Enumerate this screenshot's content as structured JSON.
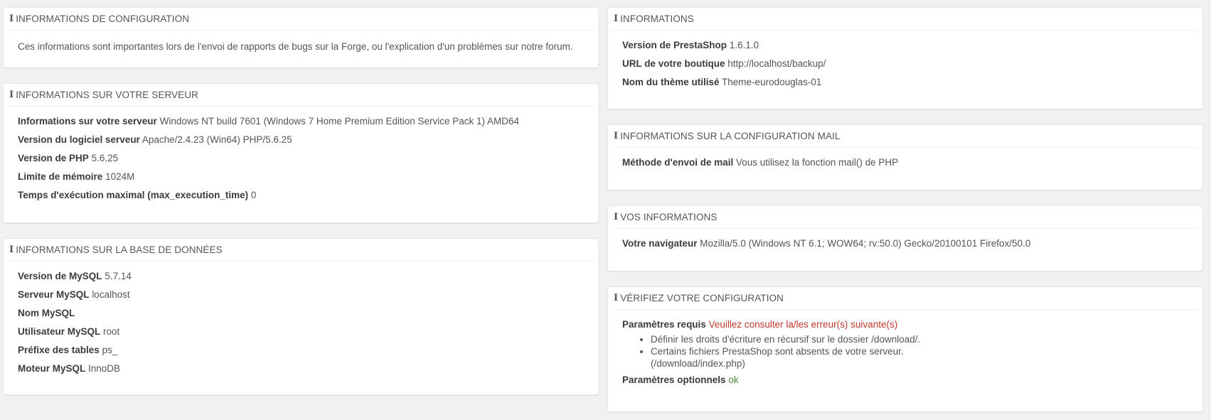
{
  "config_info": {
    "title": "INFORMATIONS DE CONFIGURATION",
    "text": "Ces informations sont importantes lors de l'envoi de rapports de bugs sur la Forge, ou l'explication d'un problèmes sur notre forum."
  },
  "server_info": {
    "title": "INFORMATIONS SUR VOTRE SERVEUR",
    "rows": [
      {
        "label": "Informations sur votre serveur",
        "value": "Windows NT build 7601 (Windows 7 Home Premium Edition Service Pack 1) AMD64"
      },
      {
        "label": "Version du logiciel serveur",
        "value": "Apache/2.4.23 (Win64) PHP/5.6.25"
      },
      {
        "label": "Version de PHP",
        "value": "5.6.25"
      },
      {
        "label": "Limite de mémoire",
        "value": "1024M"
      },
      {
        "label": "Temps d'exécution maximal (max_execution_time)",
        "value": "0"
      }
    ]
  },
  "db_info": {
    "title": "INFORMATIONS SUR LA BASE DE DONNÉES",
    "rows": [
      {
        "label": "Version de MySQL",
        "value": "5.7.14"
      },
      {
        "label": "Serveur MySQL",
        "value": "localhost"
      },
      {
        "label": "Nom MySQL",
        "value": ""
      },
      {
        "label": "Utilisateur MySQL",
        "value": "root"
      },
      {
        "label": "Préfixe des tables",
        "value": "ps_"
      },
      {
        "label": "Moteur MySQL",
        "value": "InnoDB"
      }
    ]
  },
  "shop_info": {
    "title": "INFORMATIONS",
    "rows": [
      {
        "label": "Version de PrestaShop",
        "value": "1.6.1.0"
      },
      {
        "label": "URL de votre boutique",
        "value": "http://localhost/backup/"
      },
      {
        "label": "Nom du thème utilisé",
        "value": "Theme-eurodouglas-01"
      }
    ]
  },
  "mail_info": {
    "title": "INFORMATIONS SUR LA CONFIGURATION MAIL",
    "rows": [
      {
        "label": "Méthode d'envoi de mail",
        "value": "Vous utilisez la fonction mail() de PHP"
      }
    ]
  },
  "your_info": {
    "title": "VOS INFORMATIONS",
    "rows": [
      {
        "label": "Votre navigateur",
        "value": "Mozilla/5.0 (Windows NT 6.1; WOW64; rv:50.0) Gecko/20100101 Firefox/50.0"
      }
    ]
  },
  "check_config": {
    "title": "VÉRIFIEZ VOTRE CONFIGURATION",
    "required_label": "Paramètres requis",
    "required_value": "Veuillez consulter la/les erreur(s) suivante(s)",
    "issues": [
      "Définir les droits d'écriture en récursif sur le dossier /download/.",
      "Certains fichiers PrestaShop sont absents de votre serveur.",
      "(/download/index.php)"
    ],
    "optional_label": "Paramètres optionnels",
    "optional_value": "ok"
  },
  "icon": "info-icon",
  "colors": {
    "error": "#c0392b",
    "ok": "#4b8b3b",
    "background": "#eff1f2"
  }
}
